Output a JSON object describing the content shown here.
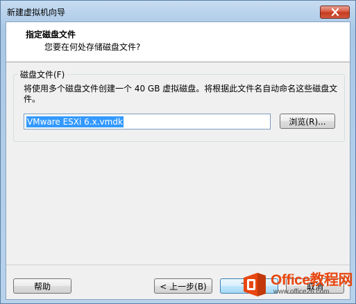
{
  "window": {
    "title": "新建虚拟机向导"
  },
  "header": {
    "title": "指定磁盘文件",
    "subtitle": "您要在何处存储磁盘文件?"
  },
  "group": {
    "label": "磁盘文件(F)",
    "description": "将使用多个磁盘文件创建一个 40 GB 虚拟磁盘。将根据此文件名自动命名这些磁盘文件。",
    "file_value": "VMware ESXi 6.x.vmdk",
    "browse_label": "浏览(R)..."
  },
  "footer": {
    "help_label": "帮助",
    "back_label": "< 上一步(B)",
    "next_label": "下一",
    "cancel_label": "取消"
  },
  "watermark": {
    "brand": "Office教程网",
    "url": "www.office26.com"
  },
  "colors": {
    "selection": "#3399ff",
    "watermark_orange": "#e8470f"
  },
  "icons": {
    "close": "close-icon",
    "logo": "office-logo-icon"
  }
}
